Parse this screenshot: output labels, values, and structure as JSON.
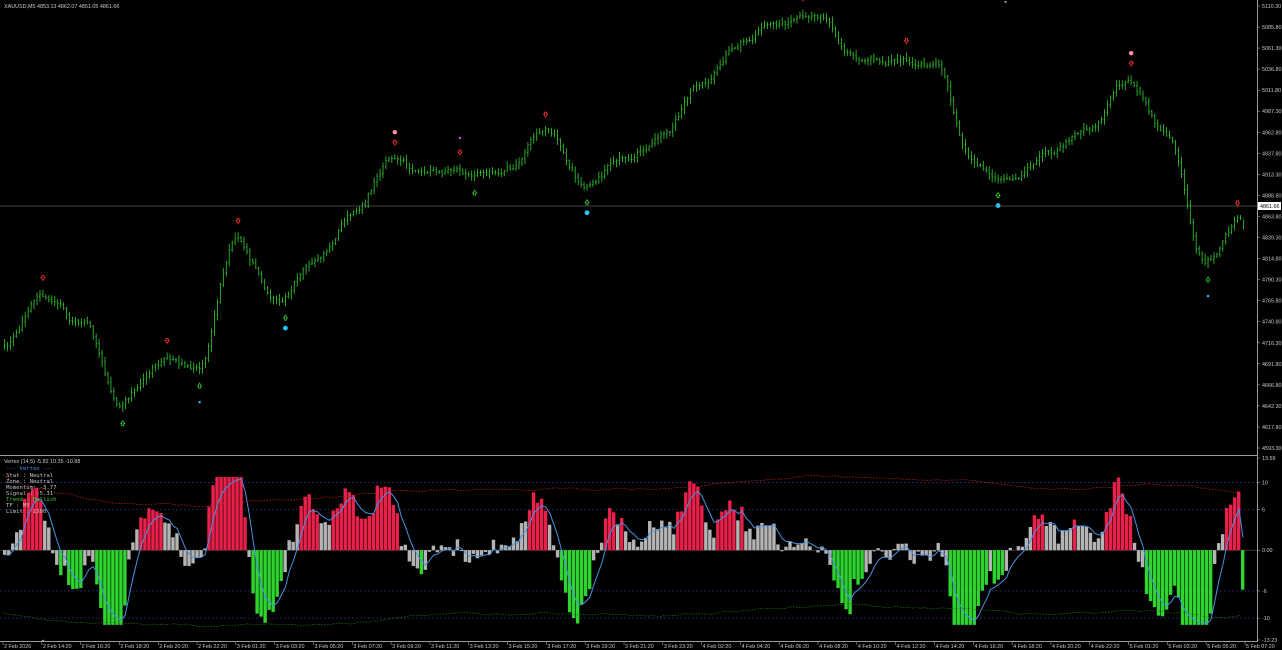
{
  "symbol_header": "XAUUSD,M5  4853.13 4862.07 4851.05 4861.66",
  "current_price_tag": "4861.66",
  "indicator": {
    "header": "Vertex (14,5) -5.82 10.35 -10.88",
    "info_title": "--- Vertex ---",
    "info_lines": [
      {
        "text": "Stat   : Neutral",
        "color": "#c0c0c0"
      },
      {
        "text": "Zone   : Neutral",
        "color": "#c0c0c0"
      },
      {
        "text": "Momentum: -3.77",
        "color": "#c0c0c0"
      },
      {
        "text": "Signal : -5.31",
        "color": "#c0c0c0"
      },
      {
        "text": "Trend  : Bullish",
        "color": "#32cd32"
      },
      {
        "text": "TF     : M5",
        "color": "#c0c0c0"
      },
      {
        "text": "Limit  : 1500",
        "color": "#c0c0c0"
      }
    ]
  },
  "price_axis_labels": [
    "5110.30",
    "5085.80",
    "5061.30",
    "5036.80",
    "5011.80",
    "4987.30",
    "4962.80",
    "4937.80",
    "4913.30",
    "4888.80",
    "4863.80",
    "4839.30",
    "4814.80",
    "4790.30",
    "4765.80",
    "4740.80",
    "4716.30",
    "4691.80",
    "4666.80",
    "4642.30",
    "4617.80",
    "4593.30"
  ],
  "indicator_axis_labels": [
    "13.59",
    "10",
    "6",
    "0.00",
    "-6",
    "-10",
    "-13.23"
  ],
  "time_axis_labels": [
    "2 Feb 2026",
    "2 Feb 14:20",
    "2 Feb 16:20",
    "2 Feb 18:20",
    "2 Feb 20:20",
    "2 Feb 22:20",
    "3 Feb 01:20",
    "3 Feb 03:20",
    "3 Feb 05:20",
    "3 Feb 07:20",
    "3 Feb 09:20",
    "3 Feb 11:20",
    "3 Feb 13:20",
    "3 Feb 15:20",
    "3 Feb 17:20",
    "3 Feb 19:20",
    "3 Feb 21:20",
    "3 Feb 23:20",
    "4 Feb 02:20",
    "4 Feb 04:20",
    "4 Feb 06:20",
    "4 Feb 08:20",
    "4 Feb 10:20",
    "4 Feb 12:20",
    "4 Feb 14:20",
    "4 Feb 16:20",
    "4 Feb 18:20",
    "4 Feb 20:20",
    "4 Feb 22:20",
    "5 Feb 01:20",
    "5 Feb 03:20",
    "5 Feb 05:20",
    "5 Feb 07:20"
  ],
  "colors": {
    "background": "#000000",
    "candle": "#32cd32",
    "sell_arrow": "#ff3030",
    "buy_arrow": "#32cd32",
    "magenta_dot": "#e040fb",
    "pink_dot": "#ff8fa8",
    "cyan_dot": "#1ec8ff",
    "hist_up_strong": "#e8204a",
    "hist_down_strong": "#2fd42f",
    "hist_neutral": "#b4b4b4",
    "signal_line": "#4a90e2",
    "upper_band": "#c82020",
    "lower_band": "#1f7a1f",
    "level_line": "#3838a0",
    "grid_sep": "#9a9a9a"
  },
  "chart_data": {
    "type": "candlestick",
    "symbol": "XAUUSD",
    "timeframe": "M5",
    "last_bar": {
      "open": 4853.13,
      "high": 4862.07,
      "low": 4851.05,
      "close": 4861.66
    },
    "y_range": [
      4593.3,
      5110.3
    ],
    "price_path_keypoints": [
      {
        "time": "2 Feb 2026",
        "price": 4720
      },
      {
        "time": "2 Feb 14:20",
        "price": 4775
      },
      {
        "time": "2 Feb 16:20",
        "price": 4740
      },
      {
        "time": "2 Feb 18:20",
        "price": 4650
      },
      {
        "time": "2 Feb 20:20",
        "price": 4700
      },
      {
        "time": "2 Feb 22:20",
        "price": 4690
      },
      {
        "time": "3 Feb 01:20",
        "price": 4840
      },
      {
        "time": "3 Feb 03:20",
        "price": 4770
      },
      {
        "time": "3 Feb 05:20",
        "price": 4820
      },
      {
        "time": "3 Feb 07:20",
        "price": 4870
      },
      {
        "time": "3 Feb 09:20",
        "price": 4930
      },
      {
        "time": "3 Feb 11:20",
        "price": 4915
      },
      {
        "time": "3 Feb 13:20",
        "price": 4915
      },
      {
        "time": "3 Feb 15:20",
        "price": 4925
      },
      {
        "time": "3 Feb 17:20",
        "price": 4970
      },
      {
        "time": "3 Feb 19:20",
        "price": 4905
      },
      {
        "time": "3 Feb 21:20",
        "price": 4935
      },
      {
        "time": "3 Feb 23:20",
        "price": 4960
      },
      {
        "time": "4 Feb 02:20",
        "price": 5020
      },
      {
        "time": "4 Feb 04:20",
        "price": 5070
      },
      {
        "time": "4 Feb 06:20",
        "price": 5090
      },
      {
        "time": "4 Feb 08:20",
        "price": 5095
      },
      {
        "time": "4 Feb 10:20",
        "price": 5050
      },
      {
        "time": "4 Feb 12:20",
        "price": 5050
      },
      {
        "time": "4 Feb 14:20",
        "price": 5045
      },
      {
        "time": "4 Feb 16:20",
        "price": 4930
      },
      {
        "time": "4 Feb 18:20",
        "price": 4905
      },
      {
        "time": "4 Feb 20:20",
        "price": 4935
      },
      {
        "time": "4 Feb 22:20",
        "price": 4965
      },
      {
        "time": "5 Feb 01:20",
        "price": 5020
      },
      {
        "time": "5 Feb 03:20",
        "price": 4960
      },
      {
        "time": "5 Feb 05:20",
        "price": 4815
      },
      {
        "time": "5 Feb 07:20",
        "price": 4862
      }
    ],
    "indicator_y_range": [
      -13.23,
      13.59
    ],
    "indicator_levels": [
      10,
      6,
      0,
      -6,
      -10
    ]
  }
}
